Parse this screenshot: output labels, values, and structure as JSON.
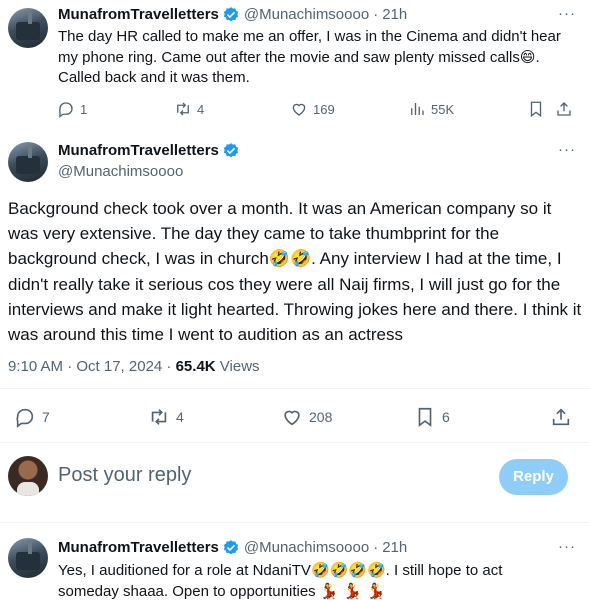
{
  "tweet1": {
    "display_name": "MunafromTravelletters",
    "handle": "@Munachimsoooo",
    "separator": "·",
    "time": "21h",
    "text": "The day HR called to make me an offer, I was in the Cinema and didn't hear my phone ring. Came out after the movie and saw plenty missed calls",
    "emoji": "😄",
    "text_end": ". Called back and it was them.",
    "replies": "1",
    "reposts": "4",
    "likes": "169",
    "views": "55K"
  },
  "main_tweet": {
    "display_name": "MunafromTravelletters",
    "handle": "@Munachimsoooo",
    "text_part1": "Background check took over a month. It was an American company so it was very extensive. The day they came to take thumbprint for the background check, I was in church",
    "emoji": "🤣🤣",
    "text_part2": ". Any interview I had at the time, I didn't really take it serious cos they were all Naij firms, I will just go for the interviews and make it light hearted. Throwing jokes here and there. I think it was around this time I went to audition as an actress",
    "time": "9:10 AM · Oct 17, 2024 · ",
    "views_count": "65.4K",
    "views_label": " Views",
    "replies": "7",
    "reposts": "4",
    "likes": "208",
    "bookmarks": "6"
  },
  "reply_box": {
    "placeholder": "Post your reply",
    "button": "Reply"
  },
  "tweet3": {
    "display_name": "MunafromTravelletters",
    "handle": "@Munachimsoooo",
    "separator": "·",
    "time": "21h",
    "text": "Yes, I auditioned for a role at NdaniTV",
    "emoji": "🤣🤣🤣🤣",
    "text_mid": ". I still hope to act someday shaaa. Open to opportunities ",
    "emoji_end": "💃 💃 💃"
  },
  "colors": {
    "accent": "#1d9bf0",
    "muted": "#536471",
    "reply_button": "#8ecdf8"
  }
}
